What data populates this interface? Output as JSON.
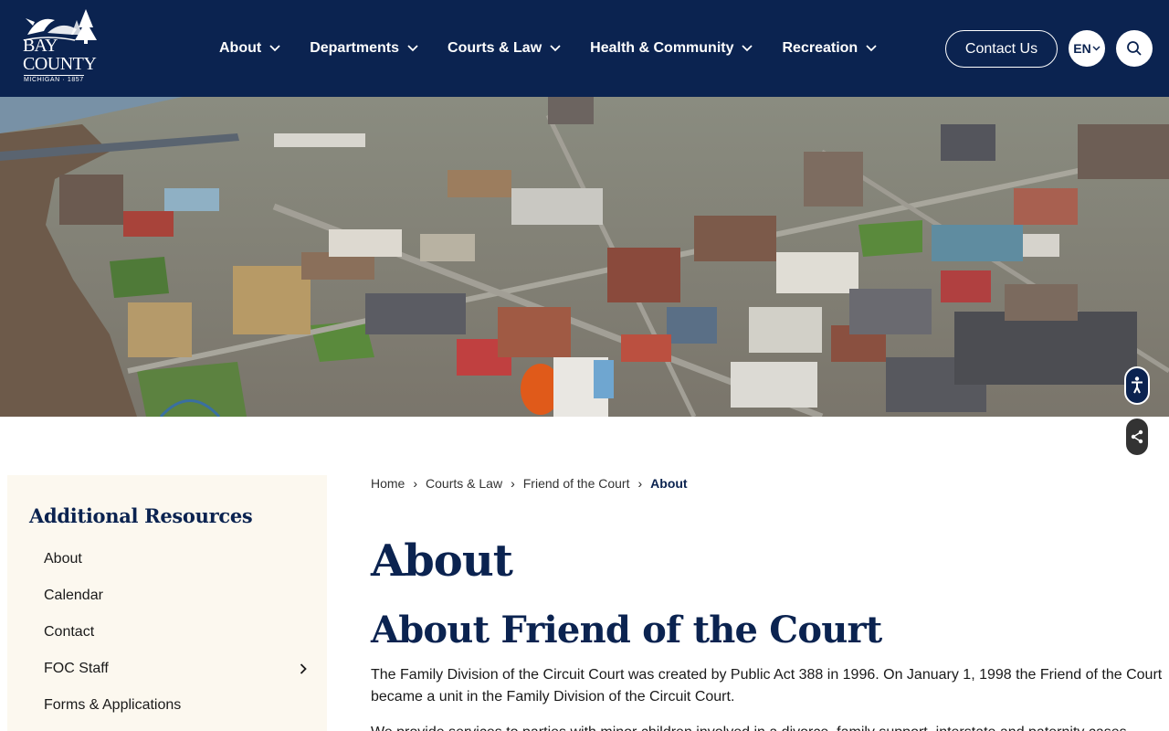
{
  "header": {
    "logo": {
      "line1": "BAY",
      "line2": "COUNTY",
      "tagline": "MICHIGAN · 1857"
    },
    "nav": [
      {
        "label": "About"
      },
      {
        "label": "Departments"
      },
      {
        "label": "Courts & Law"
      },
      {
        "label": "Health & Community"
      },
      {
        "label": "Recreation"
      }
    ],
    "contact_label": "Contact Us",
    "language": "EN"
  },
  "icons": {
    "search": "search-icon",
    "accessibility": "accessibility-icon",
    "share": "share-icon",
    "chevron": "chevron-down-icon"
  },
  "sidebar": {
    "title": "Additional Resources",
    "items": [
      {
        "label": "About",
        "has_children": false
      },
      {
        "label": "Calendar",
        "has_children": false
      },
      {
        "label": "Contact",
        "has_children": false
      },
      {
        "label": "FOC Staff",
        "has_children": true
      },
      {
        "label": "Forms & Applications",
        "has_children": false
      }
    ]
  },
  "breadcrumb": {
    "items": [
      "Home",
      "Courts & Law",
      "Friend of the Court"
    ],
    "current": "About"
  },
  "main": {
    "title": "About",
    "subtitle": "About Friend of the Court",
    "paragraph1": "The Family Division of the Circuit Court was created by Public Act 388 in 1996.  On January 1, 1998 the Friend of the Court became a unit in the Family Division of the Circuit Court.",
    "paragraph2": "We provide services to parties with minor children involved in a divorce, family support, interstate and paternity cases."
  },
  "colors": {
    "navy": "#0b2350",
    "sidebar_bg": "#fcf8ef"
  }
}
